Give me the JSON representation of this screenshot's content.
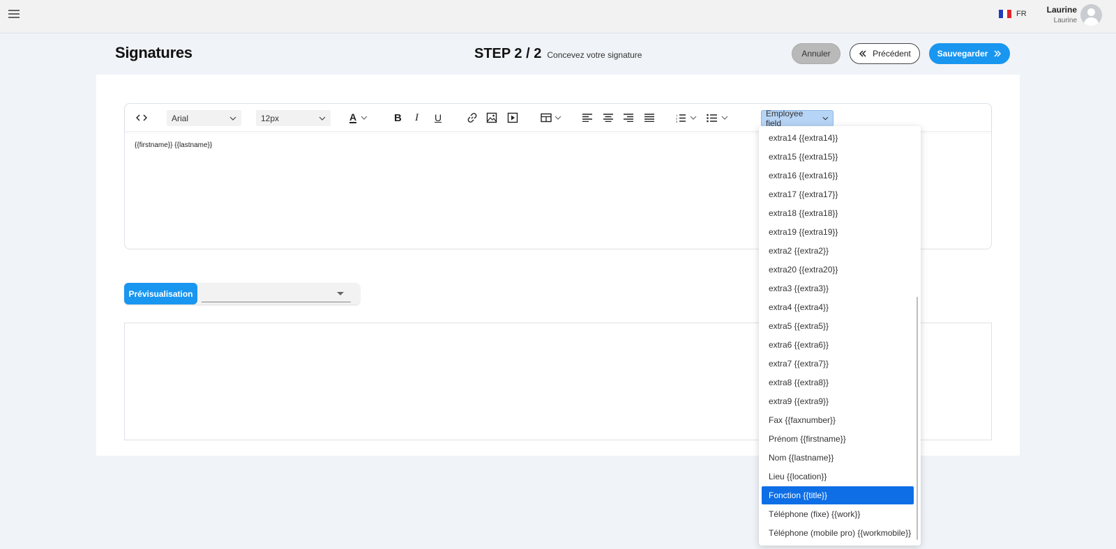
{
  "topbar": {
    "menu_icon": "hamburger-icon",
    "language": "FR",
    "flag_colors": [
      "#1f3bbf",
      "#ffffff",
      "#e0262c"
    ],
    "user_name": "Laurine",
    "user_sub": "Laurine",
    "avatar_icon": "user-avatar-icon"
  },
  "header": {
    "title": "Signatures",
    "step": "STEP 2 / 2",
    "step_subtitle": "Concevez votre signature",
    "cancel_label": "Annuler",
    "previous_label": "Précédent",
    "save_label": "Sauvegarder"
  },
  "toolbar": {
    "font_family": "Arial",
    "font_size": "12px",
    "text_color_letter": "A",
    "employee_field_label": "Employee field"
  },
  "editor": {
    "content": "{{firstname}} {{lastname}}"
  },
  "preview": {
    "label": "Prévisualisation",
    "select_value": ""
  },
  "employee_field_menu": {
    "items": [
      "extra14 {{extra14}}",
      "extra15 {{extra15}}",
      "extra16 {{extra16}}",
      "extra17 {{extra17}}",
      "extra18 {{extra18}}",
      "extra19 {{extra19}}",
      "extra2 {{extra2}}",
      "extra20 {{extra20}}",
      "extra3 {{extra3}}",
      "extra4 {{extra4}}",
      "extra5 {{extra5}}",
      "extra6 {{extra6}}",
      "extra7 {{extra7}}",
      "extra8 {{extra8}}",
      "extra9 {{extra9}}",
      "Fax {{faxnumber}}",
      "Prénom {{firstname}}",
      "Nom {{lastname}}",
      "Lieu {{location}}",
      "Fonction {{title}}",
      "Téléphone (fixe) {{work}}",
      "Téléphone (mobile pro) {{workmobile}}"
    ],
    "selected": "Fonction {{title}}"
  },
  "colors": {
    "primary": "#1996f0",
    "selected_item": "#0d6ee6",
    "employee_field_bg": "#b6d4f5"
  }
}
